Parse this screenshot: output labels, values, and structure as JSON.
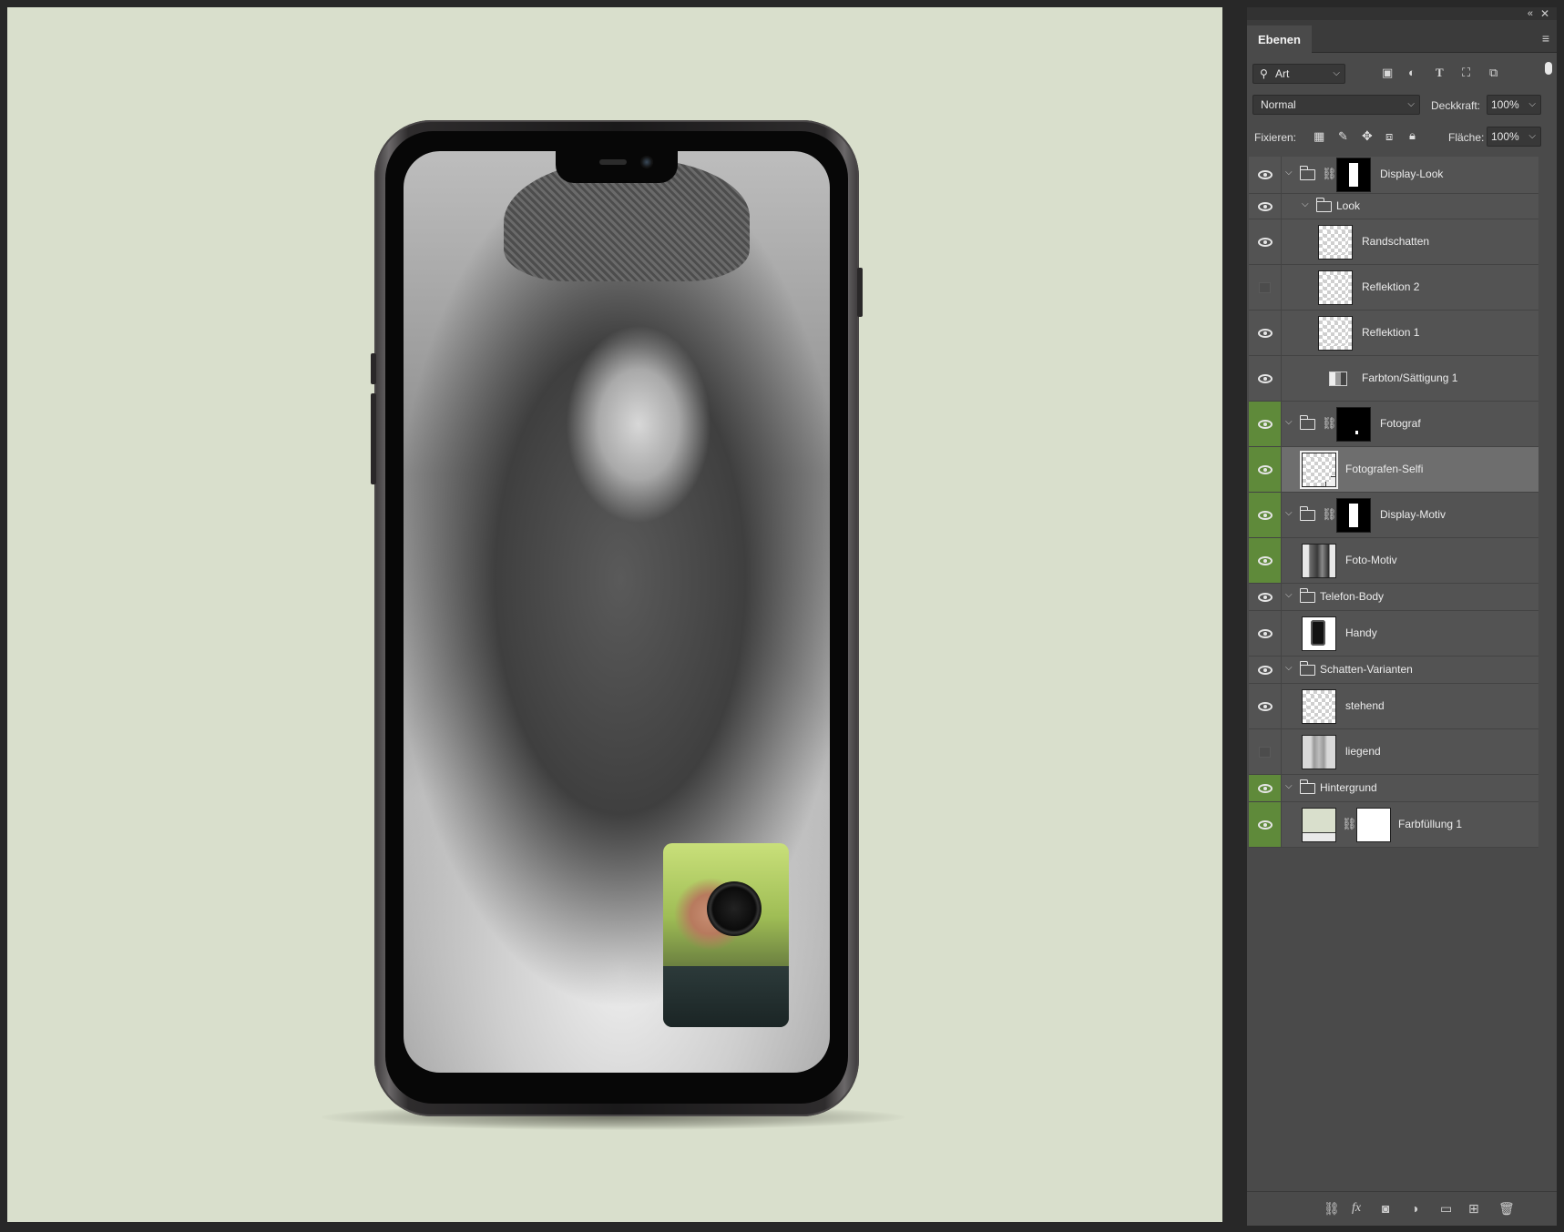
{
  "panel": {
    "tab": "Ebenen",
    "filter": {
      "label": "Art"
    },
    "blend_mode": "Normal",
    "opacity": {
      "label": "Deckkraft:",
      "value": "100%"
    },
    "lock": {
      "label": "Fixieren:"
    },
    "fill": {
      "label": "Fläche:",
      "value": "100%"
    }
  },
  "layers": [
    {
      "name": "Display-Look",
      "kind": "group-mask",
      "visible": true,
      "highlight": false,
      "mask": "white-bar"
    },
    {
      "name": "Look",
      "kind": "group",
      "visible": true,
      "highlight": false
    },
    {
      "name": "Randschatten",
      "kind": "layer",
      "visible": true,
      "highlight": false,
      "thumb": "checker"
    },
    {
      "name": "Reflektion 2",
      "kind": "layer",
      "visible": false,
      "highlight": false,
      "thumb": "checker"
    },
    {
      "name": "Reflektion 1",
      "kind": "layer",
      "visible": true,
      "highlight": false,
      "thumb": "checker"
    },
    {
      "name": "Farbton/Sättigung 1",
      "kind": "adjustment",
      "visible": true,
      "highlight": false
    },
    {
      "name": "Fotograf",
      "kind": "group-mask",
      "visible": true,
      "highlight": true,
      "mask": "black"
    },
    {
      "name": "Fotografen-Selfi",
      "kind": "smart",
      "visible": true,
      "highlight": true,
      "selected": true,
      "thumb": "checker"
    },
    {
      "name": "Display-Motiv",
      "kind": "group-mask",
      "visible": true,
      "highlight": true,
      "mask": "white-bar"
    },
    {
      "name": "Foto-Motiv",
      "kind": "layer",
      "visible": true,
      "highlight": true,
      "thumb": "photo"
    },
    {
      "name": "Telefon-Body",
      "kind": "group",
      "visible": true,
      "highlight": false
    },
    {
      "name": "Handy",
      "kind": "layer",
      "visible": true,
      "highlight": false,
      "thumb": "handy"
    },
    {
      "name": "Schatten-Varianten",
      "kind": "group",
      "visible": true,
      "highlight": false
    },
    {
      "name": "stehend",
      "kind": "layer",
      "visible": true,
      "highlight": false,
      "thumb": "checker"
    },
    {
      "name": "liegend",
      "kind": "layer",
      "visible": false,
      "highlight": false,
      "thumb": "liegend"
    },
    {
      "name": "Hintergrund",
      "kind": "group",
      "visible": true,
      "highlight": true
    },
    {
      "name": "Farbfüllung 1",
      "kind": "fill",
      "visible": true,
      "highlight": true,
      "thumb": "farb"
    }
  ],
  "colors": {
    "canvas_background": "#d9dfcc",
    "panel_background": "#4a4a4a",
    "highlight_green": "#5f8a3a",
    "selected_row": "#6e6e6e"
  },
  "icons": {
    "filter_icons": [
      "image-filter-icon",
      "adjustment-filter-icon",
      "type-filter-icon",
      "shape-filter-icon",
      "smartobject-filter-icon"
    ],
    "lock_icons": [
      "lock-transparent-icon",
      "lock-pixels-icon",
      "lock-position-icon",
      "lock-artboard-icon",
      "lock-all-icon"
    ],
    "footer_icons": [
      "link-layers-icon",
      "fx-icon",
      "add-mask-icon",
      "new-adjustment-icon",
      "new-group-icon",
      "new-layer-icon",
      "delete-layer-icon"
    ]
  }
}
